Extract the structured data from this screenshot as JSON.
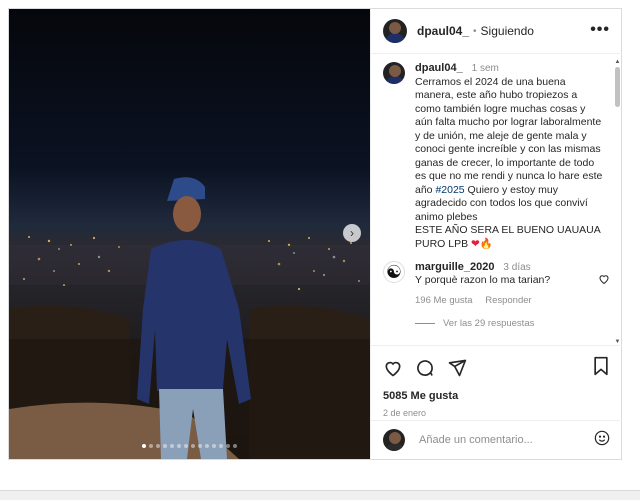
{
  "header": {
    "username": "dpaul04_",
    "separator": "•",
    "follow_status": "Siguiendo",
    "more_icon": "more-horizontal-icon"
  },
  "caption": {
    "username": "dpaul04_",
    "time": "1 sem",
    "text_1": "Cerramos el 2024 de una buena manera, este año hubo tropiezos a como también logre muchas cosas y aún falta mucho por lograr laboralmente y de unión, me aleje de gente mala y conoci gente increíble y con las mismas ganas de crecer, lo importante de todo es que no me rendi y nunca lo hare este año ",
    "hashtag": "#2025",
    "text_2": " Quiero y estoy muy agradecido con todos los que conviví animo plebes",
    "text_3": "ESTE AÑO SERA EL BUENO UAUAUA PURO LPB ",
    "emoji_heart": "❤",
    "emoji_fire": "🔥"
  },
  "comment": {
    "avatar_glyph": "☯",
    "username": "marguille_2020",
    "time": "3 días",
    "text": "Y porquè razon lo ma tarian?",
    "likes": "196 Me gusta",
    "reply": "Responder",
    "view_replies": "Ver las 29 respuestas"
  },
  "actions": {
    "likes": "5085 Me gusta",
    "date": "2 de enero"
  },
  "add_comment": {
    "placeholder": "Añade un comentario..."
  },
  "media": {
    "carousel_next_glyph": "›",
    "carousel_total": 14,
    "carousel_active": 1
  }
}
